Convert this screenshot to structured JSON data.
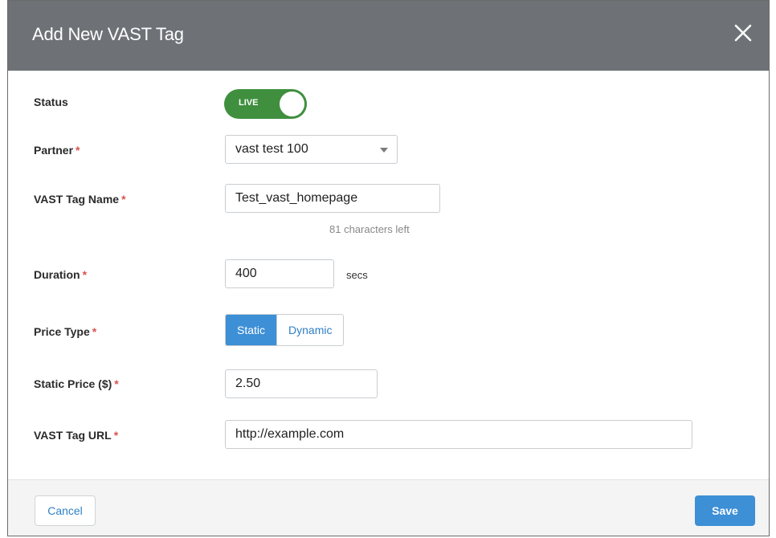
{
  "dialog": {
    "title": "Add New VAST Tag"
  },
  "form": {
    "status": {
      "label": "Status",
      "toggle_text": "LIVE",
      "state": "on"
    },
    "partner": {
      "label": "Partner",
      "selected": "vast test 100"
    },
    "tag_name": {
      "label": "VAST Tag Name",
      "value": "Test_vast_homepage",
      "hint": "81 characters left"
    },
    "duration": {
      "label": "Duration",
      "value": "400",
      "suffix": "secs"
    },
    "price_type": {
      "label": "Price Type",
      "options": [
        "Static",
        "Dynamic"
      ],
      "selected": "Static"
    },
    "static_price": {
      "label": "Static Price ($)",
      "value": "2.50"
    },
    "tag_url": {
      "label": "VAST Tag URL",
      "value": "http://example.com"
    },
    "required_marker": "*"
  },
  "footer": {
    "cancel_label": "Cancel",
    "save_label": "Save"
  },
  "colors": {
    "header_bg": "#6e7276",
    "toggle_on": "#3f8f3f",
    "accent": "#3d8fd6",
    "required": "#d9534f"
  },
  "icons": {
    "close": "close-icon",
    "dropdown": "chevron-down-icon"
  }
}
